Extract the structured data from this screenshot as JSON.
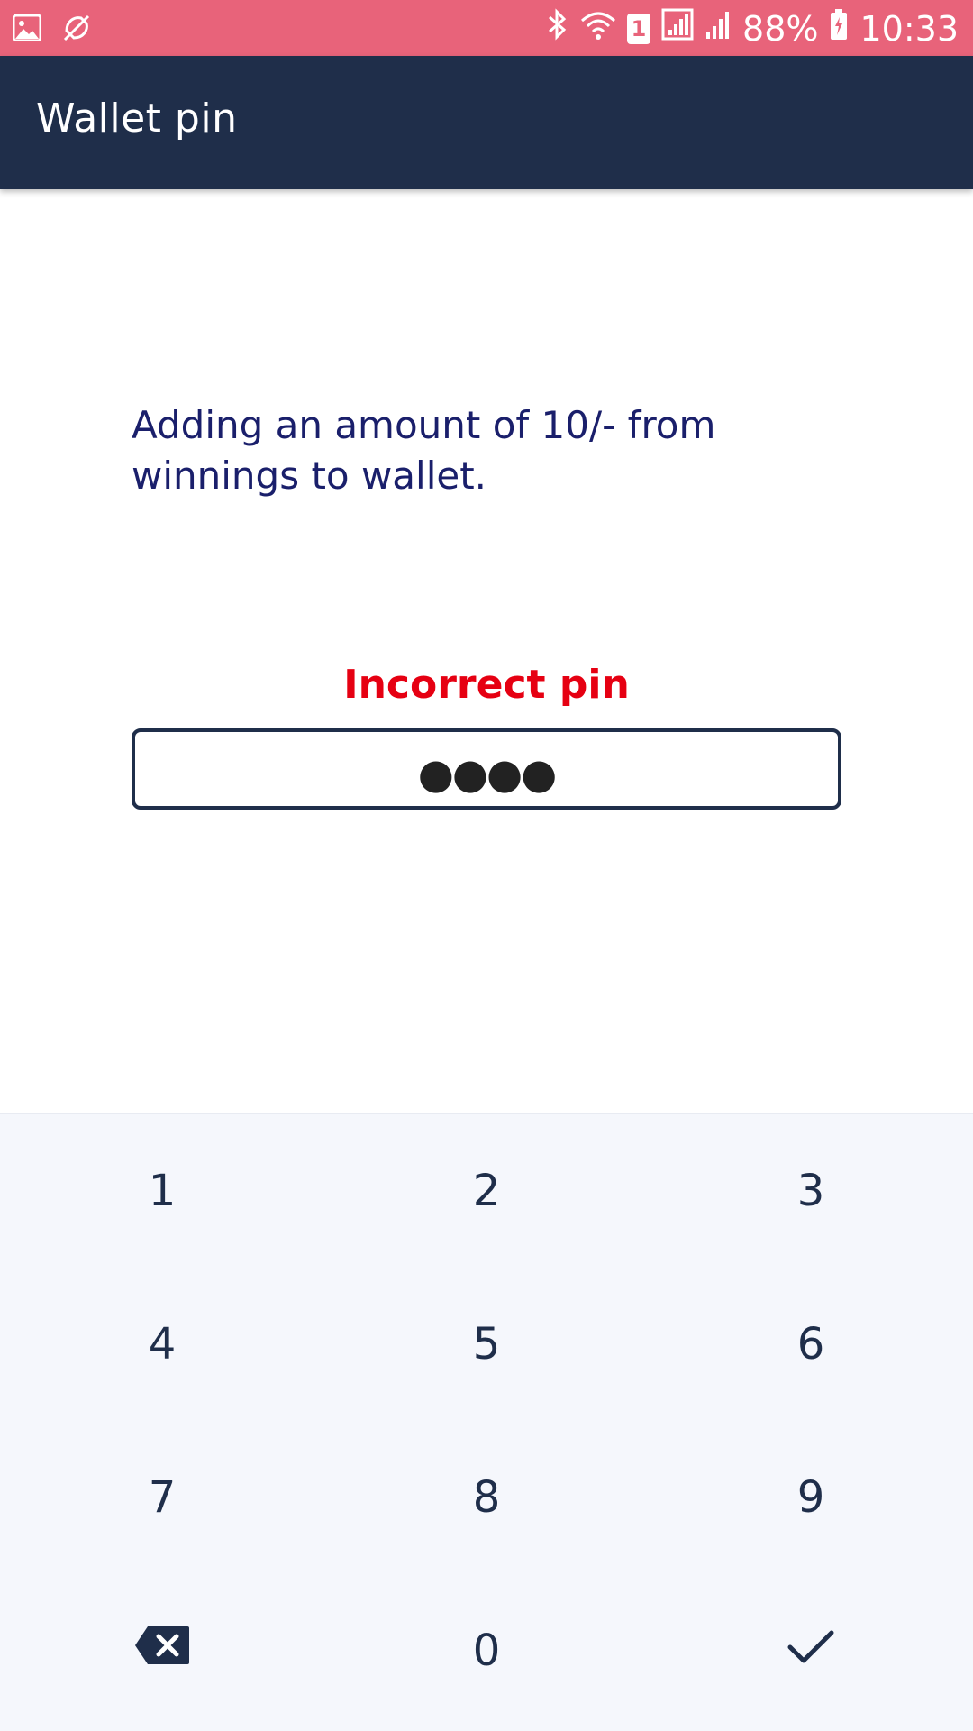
{
  "status_bar": {
    "icons_left": [
      "image-icon",
      "mute-icon"
    ],
    "icons_right": [
      "bluetooth-icon",
      "wifi-icon",
      "sim-icon",
      "signal-icon",
      "signal-icon",
      "battery-icon"
    ],
    "sim_badge": "1",
    "battery": "88%",
    "time": "10:33",
    "color": "#e8637a"
  },
  "app_bar": {
    "title": "Wallet pin",
    "color": "#1f2e4a"
  },
  "message": {
    "line1": "Adding an amount of 10/- from",
    "line2": "winnings to wallet."
  },
  "error": {
    "text": "Incorrect pin",
    "color": "#e60012"
  },
  "pin_input": {
    "value": "●●●●"
  },
  "keypad": {
    "keys": [
      "1",
      "2",
      "3",
      "4",
      "5",
      "6",
      "7",
      "8",
      "9",
      "0"
    ],
    "backspace_icon": "backspace-icon",
    "confirm_icon": "check-icon"
  }
}
